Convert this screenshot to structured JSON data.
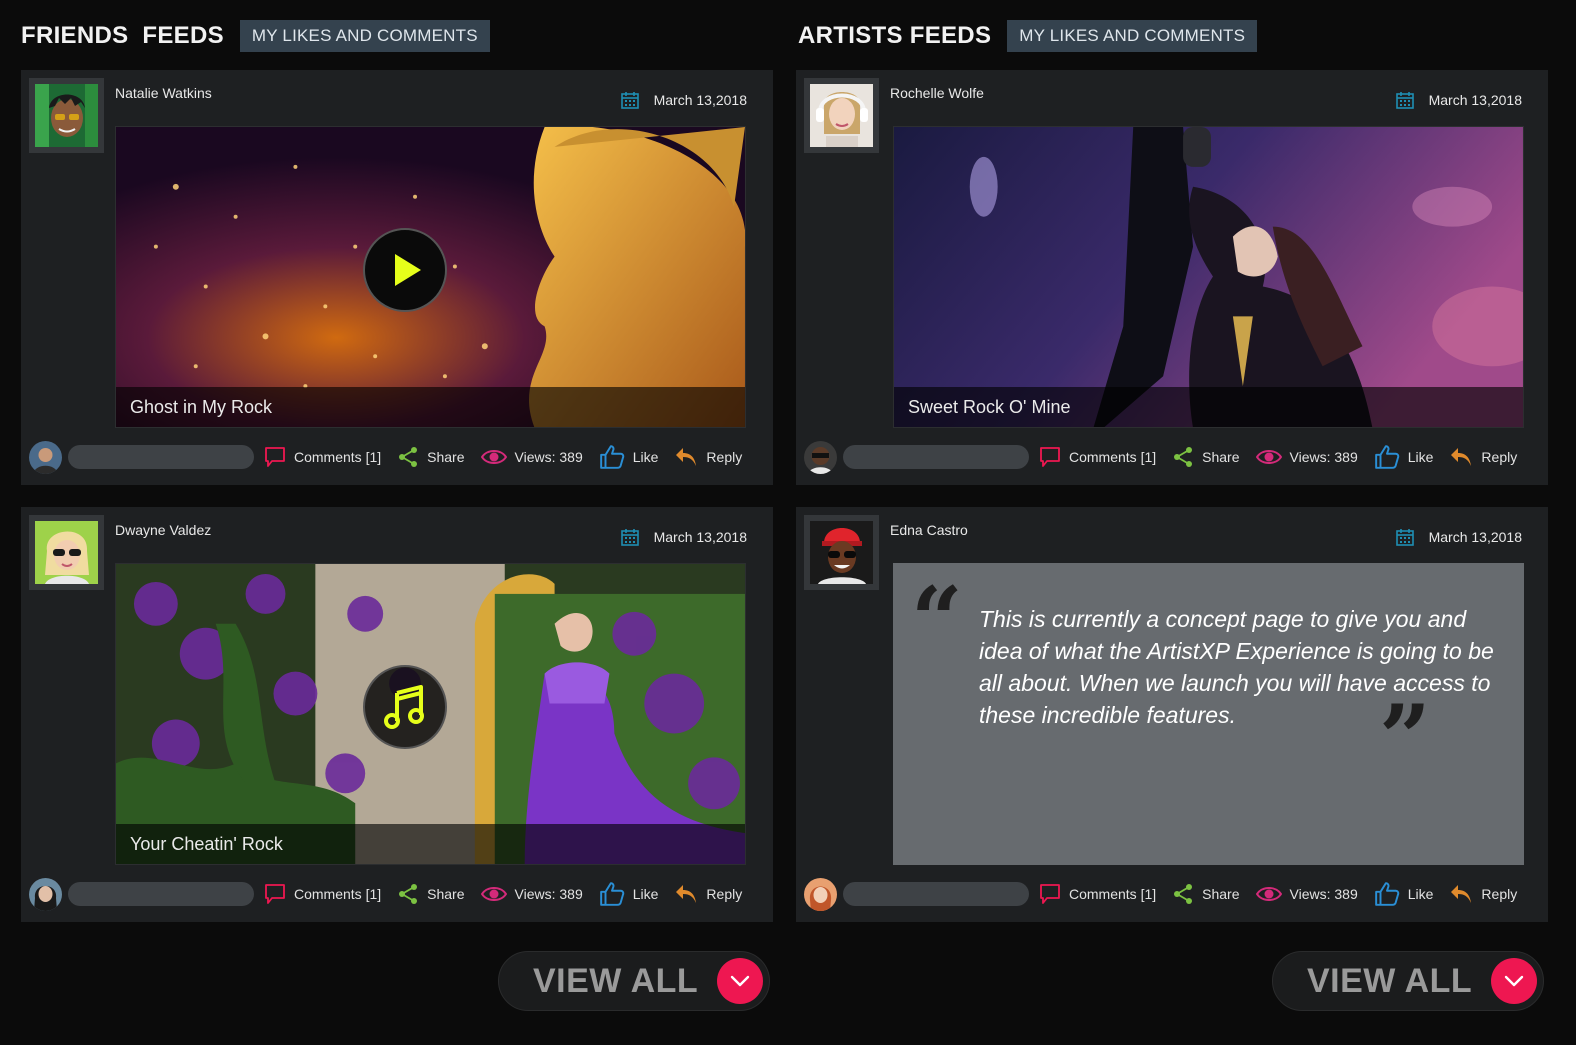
{
  "friends": {
    "title": "FRIENDS  FEEDS",
    "tab": "MY LIKES AND COMMENTS",
    "view_all": "VIEW ALL"
  },
  "artists": {
    "title": "ARTISTS FEEDS",
    "tab": "MY LIKES AND COMMENTS",
    "view_all": "VIEW ALL"
  },
  "actions": {
    "comments": "Comments [1]",
    "share": "Share",
    "views": "Views: 389",
    "like": "Like",
    "reply": "Reply"
  },
  "colors": {
    "accent_pink": "#ee1751",
    "share_green": "#7cc242",
    "like_blue": "#2a8fd6",
    "reply_orange": "#e08a2c",
    "calendar_teal": "#1f8fb3",
    "tab_bg": "#34424e"
  },
  "posts": [
    {
      "user": "Natalie Watkins",
      "date": "March  13,2018",
      "caption": "Ghost in My Rock",
      "media_icon": "play-icon"
    },
    {
      "user": "Rochelle Wolfe",
      "date": "March  13,2018",
      "caption": "Sweet Rock O' Mine",
      "media_icon": ""
    },
    {
      "user": "Dwayne Valdez",
      "date": "March  13,2018",
      "caption": "Your Cheatin' Rock",
      "media_icon": "music-note-icon"
    },
    {
      "user": "Edna Castro",
      "date": "March  13,2018",
      "quote": "This is currently a concept page to give you and idea of what the ArtistXP Experience is going to be all about. When we launch you will have access to these incredible features."
    }
  ]
}
